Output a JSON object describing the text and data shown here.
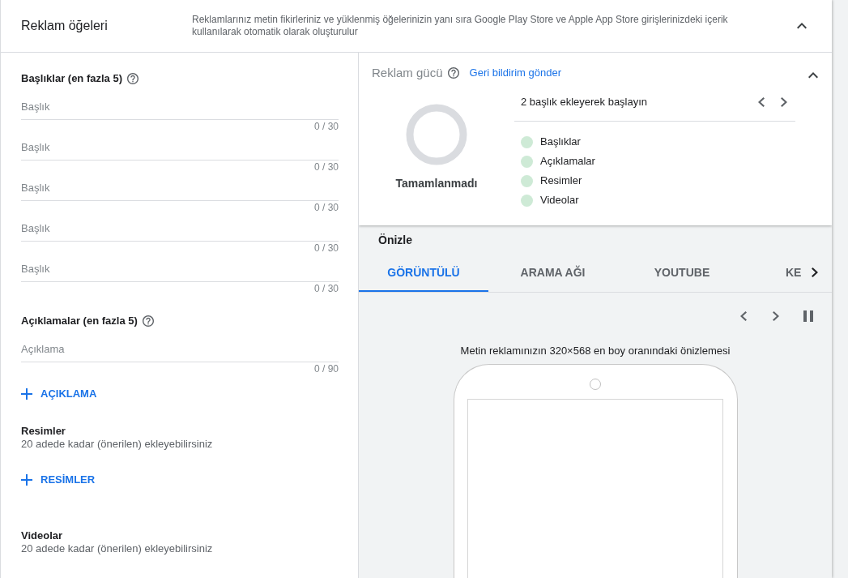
{
  "header": {
    "title": "Reklam öğeleri",
    "description": "Reklamlarınız metin fikirleriniz ve yüklenmiş öğelerinizin yanı sıra Google Play Store ve Apple App Store girişlerinizdeki içerik kullanılarak otomatik olarak oluşturulur",
    "expanded": true
  },
  "headlines": {
    "label": "Başlıklar (en fazla 5)",
    "fields": [
      {
        "placeholder": "Başlık",
        "counter": "0 / 30"
      },
      {
        "placeholder": "Başlık",
        "counter": "0 / 30"
      },
      {
        "placeholder": "Başlık",
        "counter": "0 / 30"
      },
      {
        "placeholder": "Başlık",
        "counter": "0 / 30"
      },
      {
        "placeholder": "Başlık",
        "counter": "0 / 30"
      }
    ]
  },
  "descriptions": {
    "label": "Açıklamalar (en fazla 5)",
    "fields": [
      {
        "placeholder": "Açıklama",
        "counter": "0 / 90"
      }
    ],
    "add_button": "AÇIKLAMA"
  },
  "images": {
    "title": "Resimler",
    "subtitle": "20 adede kadar (önerilen) ekleyebilirsiniz",
    "add_button": "RESİMLER"
  },
  "videos": {
    "title": "Videolar",
    "subtitle": "20 adede kadar (önerilen) ekleyebilirsiniz"
  },
  "ad_strength": {
    "title": "Reklam gücü",
    "feedback_link": "Geri bildirim gönder",
    "expanded": true,
    "status": "Tamamlanmadı",
    "tip": "2 başlık ekleyerek başlayın",
    "items": [
      {
        "label": "Başlıklar"
      },
      {
        "label": "Açıklamalar"
      },
      {
        "label": "Resimler"
      },
      {
        "label": "Videolar"
      }
    ]
  },
  "preview": {
    "title": "Önizle",
    "tabs": [
      {
        "label": "GÖRÜNTÜLÜ",
        "selected": true
      },
      {
        "label": "ARAMA AĞI",
        "selected": false
      },
      {
        "label": "YOUTUBE",
        "selected": false
      },
      {
        "label": "KE",
        "selected": false
      }
    ],
    "caption": "Metin reklamınızın 320×568 en boy oranındaki önizlemesi"
  }
}
